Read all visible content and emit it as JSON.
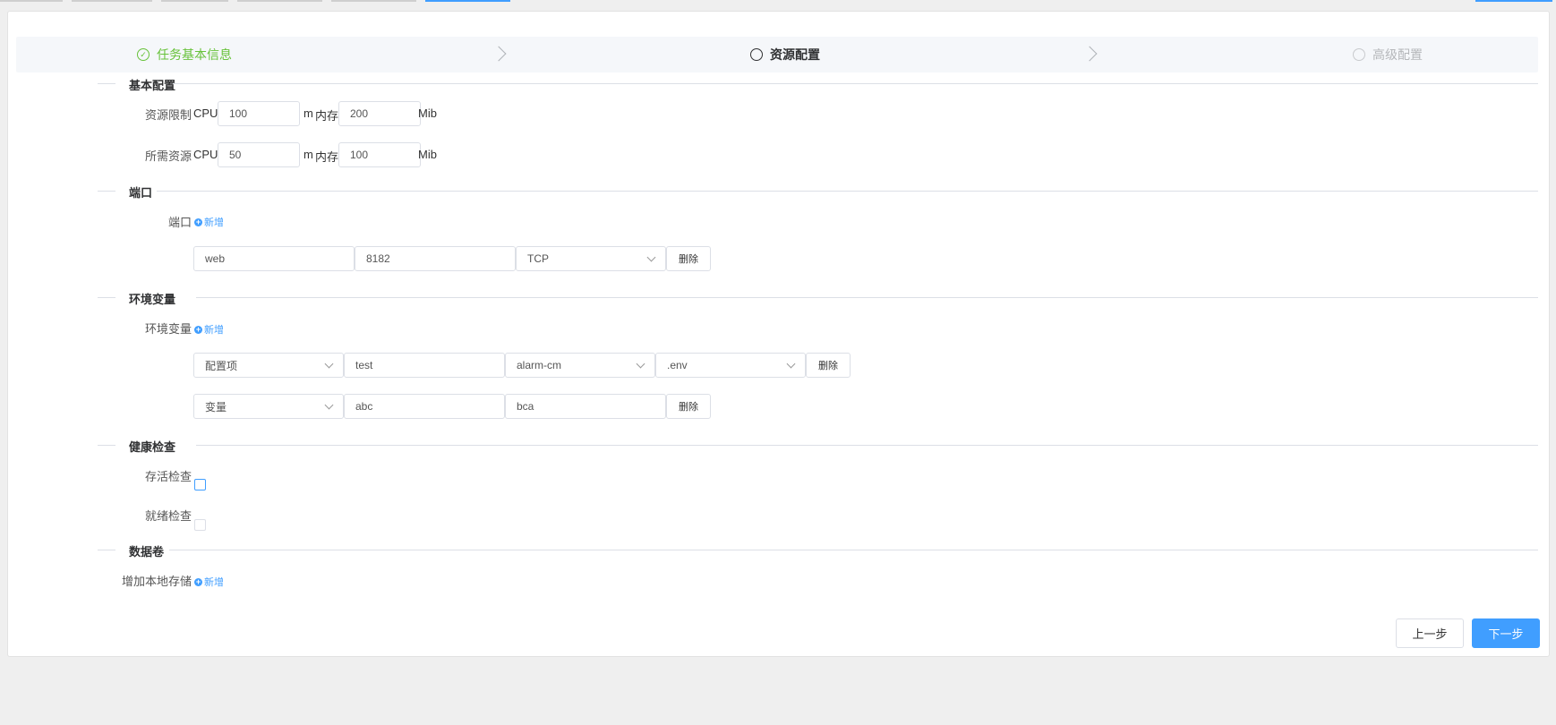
{
  "steps": [
    {
      "label": "任务基本信息",
      "state": "done"
    },
    {
      "label": "资源配置",
      "state": "active"
    },
    {
      "label": "高级配置",
      "state": "wait"
    }
  ],
  "sections": {
    "basic": "基本配置",
    "port": "端口",
    "env": "环境变量",
    "health": "健康检查",
    "volume": "数据卷"
  },
  "resources": {
    "limit_label": "资源限制",
    "request_label": "所需资源",
    "cpu_prefix": "CPU",
    "cpu_unit": "m",
    "mem_prefix": "内存",
    "mem_unit": "Mib",
    "limit": {
      "cpu": "100",
      "mem": "200"
    },
    "request": {
      "cpu": "50",
      "mem": "100"
    }
  },
  "ports": {
    "label": "端口",
    "add": "新增",
    "rows": [
      {
        "name": "web",
        "port": "8182",
        "protocol": "TCP",
        "delete": "删除"
      }
    ]
  },
  "env": {
    "label": "环境变量",
    "add": "新增",
    "rows": [
      {
        "type": "配置项",
        "name": "test",
        "configmap": "alarm-cm",
        "key": ".env",
        "delete": "删除"
      },
      {
        "type": "变量",
        "name": "abc",
        "value": "bca",
        "delete": "删除"
      }
    ]
  },
  "health": {
    "liveness": "存活检查",
    "readiness": "就绪检查"
  },
  "volume": {
    "label": "增加本地存储",
    "add": "新增"
  },
  "footer": {
    "prev": "上一步",
    "next": "下一步"
  },
  "colors": {
    "primary": "#409eff",
    "success": "#67c23a"
  }
}
